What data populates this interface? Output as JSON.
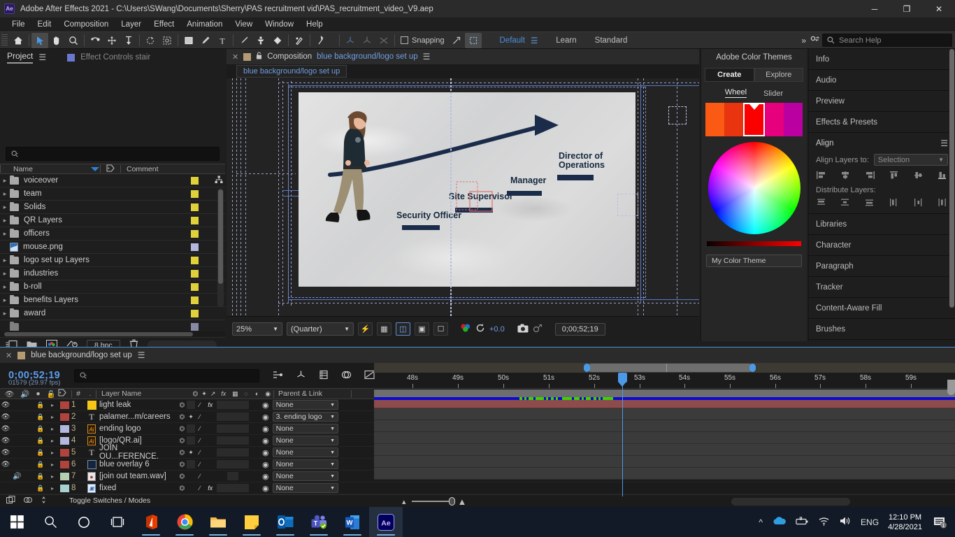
{
  "window": {
    "app_icon": "ae-logo",
    "title": "Adobe After Effects 2021 - C:\\Users\\SWang\\Documents\\Sherry\\PAS recruitment vid\\PAS_recruitment_video_V9.aep",
    "minimize": "─",
    "maximize": "❐",
    "close": "✕"
  },
  "menubar": [
    "File",
    "Edit",
    "Composition",
    "Layer",
    "Effect",
    "Animation",
    "View",
    "Window",
    "Help"
  ],
  "toolbar": {
    "tools": [
      {
        "name": "home-icon",
        "glyph": "⌂",
        "active": false
      },
      {
        "name": "selection-tool",
        "glyph": "➤",
        "active": true
      },
      {
        "name": "hand-tool",
        "glyph": "✋",
        "active": false
      },
      {
        "name": "zoom-tool",
        "glyph": "⌕",
        "active": false
      },
      {
        "name": "rotation-tool",
        "glyph": "↻",
        "active": false
      },
      {
        "name": "unified-camera-tool",
        "glyph": "✥",
        "active": false
      },
      {
        "name": "pan-behind-tool",
        "glyph": "↓",
        "active": false
      },
      {
        "name": "roto-brush-tool",
        "glyph": "◌",
        "active": false
      },
      {
        "name": "refine-edge-tool",
        "glyph": "⬚",
        "active": false
      },
      {
        "name": "shape-tool",
        "glyph": "■",
        "active": false
      },
      {
        "name": "pen-tool",
        "glyph": "✒",
        "active": false
      },
      {
        "name": "type-tool",
        "glyph": "T",
        "active": false
      },
      {
        "name": "brush-tool",
        "glyph": "╱",
        "active": false
      },
      {
        "name": "clone-stamp-tool",
        "glyph": "⚓",
        "active": false
      },
      {
        "name": "eraser-tool",
        "glyph": "◆",
        "active": false
      },
      {
        "name": "puppet-pin-tool",
        "glyph": "✐",
        "active": false
      },
      {
        "name": "puppet-starch-tool",
        "glyph": "✦",
        "active": false
      }
    ],
    "axis_tools": [
      "local-axis-mode",
      "world-axis-mode",
      "view-axis-mode"
    ],
    "snapping_label": "Snapping",
    "snapping_checked": false,
    "workspace_default": "Default",
    "workspace_learn": "Learn",
    "workspace_standard": "Standard",
    "overflow": "»",
    "search_help_placeholder": "Search Help"
  },
  "project_panel": {
    "tab_title": "Project",
    "effect_controls_tab": "Effect Controls   stair",
    "search_placeholder": "",
    "columns": [
      "Name",
      "Comment"
    ],
    "items": [
      {
        "name": "voiceover",
        "type": "folder",
        "label_color": "#e0d13a"
      },
      {
        "name": "team",
        "type": "folder",
        "label_color": "#e0d13a"
      },
      {
        "name": "Solids",
        "type": "folder",
        "label_color": "#e0d13a"
      },
      {
        "name": "QR Layers",
        "type": "folder",
        "label_color": "#e0d13a"
      },
      {
        "name": "officers",
        "type": "folder",
        "label_color": "#e0d13a"
      },
      {
        "name": "mouse.png",
        "type": "file",
        "label_color": "#b5b8de"
      },
      {
        "name": "logo set up Layers",
        "type": "folder",
        "label_color": "#e0d13a"
      },
      {
        "name": "industries",
        "type": "folder",
        "label_color": "#e0d13a"
      },
      {
        "name": "b-roll",
        "type": "folder",
        "label_color": "#e0d13a"
      },
      {
        "name": "benefits Layers",
        "type": "folder",
        "label_color": "#e0d13a"
      },
      {
        "name": "award",
        "type": "folder",
        "label_color": "#e0d13a"
      }
    ],
    "footer": {
      "bit_depth": "8 bpc"
    }
  },
  "composition_panel": {
    "tab_label": "Composition",
    "comp_name": "blue background/logo set up",
    "breadcrumb": "blue background/logo set up",
    "viewer": {
      "headline_labels": [
        {
          "text": "Security Officer"
        },
        {
          "text": "Site Supervisor"
        },
        {
          "text": "Manager"
        },
        {
          "text": "Director of"
        },
        {
          "text": "Operations"
        }
      ]
    },
    "footer": {
      "zoom": "25%",
      "resolution": "(Quarter)",
      "exposure": "+0.0",
      "timecode": "0;00;52;19"
    }
  },
  "color_themes_panel": {
    "title": "Adobe Color Themes",
    "tabs": [
      "Create",
      "Explore"
    ],
    "active_tab": "Create",
    "modes": [
      "Wheel",
      "Slider"
    ],
    "active_mode": "Wheel",
    "swatches": [
      "#fa5a14",
      "#e8340f",
      "#fb0000",
      "#e6007e",
      "#ba00a0"
    ],
    "selected_swatch_index": 2,
    "theme_name": "My Color Theme"
  },
  "right_panels": [
    {
      "label": "Info"
    },
    {
      "label": "Audio"
    },
    {
      "label": "Preview"
    },
    {
      "label": "Effects & Presets"
    }
  ],
  "align_panel": {
    "title": "Align",
    "align_layers_to_label": "Align Layers to:",
    "align_layers_to_value": "Selection",
    "distribute_label": "Distribute Layers:"
  },
  "right_panels_bottom": [
    {
      "label": "Libraries"
    },
    {
      "label": "Character"
    },
    {
      "label": "Paragraph"
    },
    {
      "label": "Tracker"
    },
    {
      "label": "Content-Aware Fill"
    },
    {
      "label": "Brushes"
    }
  ],
  "timeline": {
    "tab_name": "blue background/logo set up",
    "current_time": "0;00;52;19",
    "frame_info": "01579 (29.97 fps)",
    "search_placeholder": "",
    "columns": {
      "layer_name": "Layer Name",
      "parent_link": "Parent & Link",
      "num": "#"
    },
    "layers": [
      {
        "num": "1",
        "name": "light leak",
        "type": "solid",
        "label_color": "#b0443c",
        "icon_color": "#f5c518",
        "video": true,
        "audio": false,
        "locked": true,
        "fx": true,
        "parent": "None"
      },
      {
        "num": "2",
        "name": "palamer...m/careers",
        "type": "text",
        "label_color": "#b0443c",
        "video": true,
        "audio": false,
        "locked": true,
        "fx": false,
        "parent": "3. ending logo"
      },
      {
        "num": "3",
        "name": "ending logo",
        "type": "ai",
        "label_color": "#b5b8de",
        "video": true,
        "audio": false,
        "locked": true,
        "fx": false,
        "parent": "None"
      },
      {
        "num": "4",
        "name": "[logo/QR.ai]",
        "type": "ai",
        "label_color": "#b5b8de",
        "video": true,
        "audio": false,
        "locked": true,
        "fx": false,
        "parent": "None"
      },
      {
        "num": "5",
        "name": "JOIN OU...FERENCE.",
        "type": "text",
        "label_color": "#b0443c",
        "video": true,
        "audio": false,
        "locked": true,
        "fx": false,
        "parent": "None"
      },
      {
        "num": "6",
        "name": "blue overlay 6",
        "type": "solid",
        "label_color": "#b0443c",
        "icon_color": "#12253c",
        "video": true,
        "audio": false,
        "locked": true,
        "fx": false,
        "parent": "None"
      },
      {
        "num": "7",
        "name": "[join out team.wav]",
        "type": "audio",
        "label_color": "#b6cfb0",
        "video": false,
        "audio": true,
        "locked": true,
        "fx": false,
        "parent": "None"
      },
      {
        "num": "8",
        "name": "fixed",
        "type": "video",
        "label_color": "#a8d2cf",
        "video": false,
        "audio": false,
        "locked": true,
        "fx": true,
        "parent": "None"
      }
    ],
    "footer_label": "Toggle Switches / Modes",
    "ruler_ticks": [
      "48s",
      "49s",
      "50s",
      "51s",
      "52s",
      "53s",
      "54s",
      "55s",
      "56s",
      "57s",
      "58s",
      "59s"
    ]
  },
  "taskbar": {
    "items": [
      {
        "name": "start-button",
        "glyph": "win"
      },
      {
        "name": "search-icon",
        "glyph": "⌕"
      },
      {
        "name": "cortana-icon",
        "glyph": "○"
      },
      {
        "name": "task-view-icon",
        "glyph": "❑"
      },
      {
        "name": "office-icon",
        "glyph": "office"
      },
      {
        "name": "chrome-icon",
        "glyph": "chrome"
      },
      {
        "name": "file-explorer-icon",
        "glyph": "folder"
      },
      {
        "name": "sticky-notes-icon",
        "glyph": "note"
      },
      {
        "name": "outlook-icon",
        "glyph": "O"
      },
      {
        "name": "teams-icon",
        "glyph": "T"
      },
      {
        "name": "word-icon",
        "glyph": "W"
      },
      {
        "name": "after-effects-icon",
        "glyph": "Ae"
      }
    ],
    "tray": {
      "show_hidden": "∧",
      "onedrive": "onedrive",
      "battery": "battery",
      "wifi": "wifi",
      "volume": "volume",
      "language": "ENG",
      "time": "12:10 PM",
      "date": "4/28/2021",
      "notification_count": "1"
    }
  }
}
